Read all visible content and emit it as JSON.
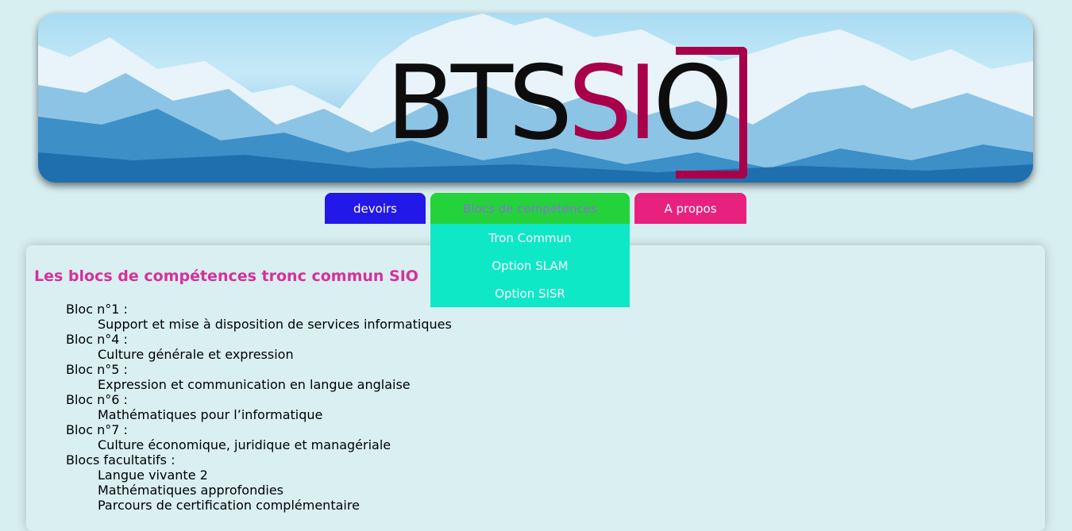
{
  "header": {
    "logo": {
      "part1": "BTS",
      "part2": "SI",
      "part3": "O"
    }
  },
  "nav": {
    "items": [
      {
        "label": "devoirs",
        "color": "#2218e8"
      },
      {
        "label": "Blocs de compétences",
        "color": "#24d33c"
      },
      {
        "label": "A propos",
        "color": "#e8217f"
      }
    ],
    "dropdown": [
      {
        "label": "Tron Commun"
      },
      {
        "label": "Option SLAM"
      },
      {
        "label": "Option SISR"
      }
    ],
    "dropdown_color": "#0ee8c6"
  },
  "content": {
    "title": "Les blocs de compétences tronc commun SIO",
    "blocs": [
      {
        "name": "Bloc n°1 :",
        "items": [
          "Support et mise à disposition de services informatiques"
        ]
      },
      {
        "name": "Bloc n°4 :",
        "items": [
          "Culture générale et expression"
        ]
      },
      {
        "name": "Bloc n°5 :",
        "items": [
          "Expression et communication en langue anglaise"
        ]
      },
      {
        "name": "Bloc n°6 :",
        "items": [
          "Mathématiques pour l’informatique"
        ]
      },
      {
        "name": "Bloc n°7 :",
        "items": [
          "Culture économique, juridique et managériale"
        ]
      },
      {
        "name": "Blocs facultatifs :",
        "items": [
          "Langue vivante 2",
          "Mathématiques approfondies",
          "Parcours de certification complémentaire"
        ]
      }
    ]
  },
  "colors": {
    "title": "#d6309a",
    "background": "#d8eff2",
    "logo_accent": "#a8004a"
  }
}
